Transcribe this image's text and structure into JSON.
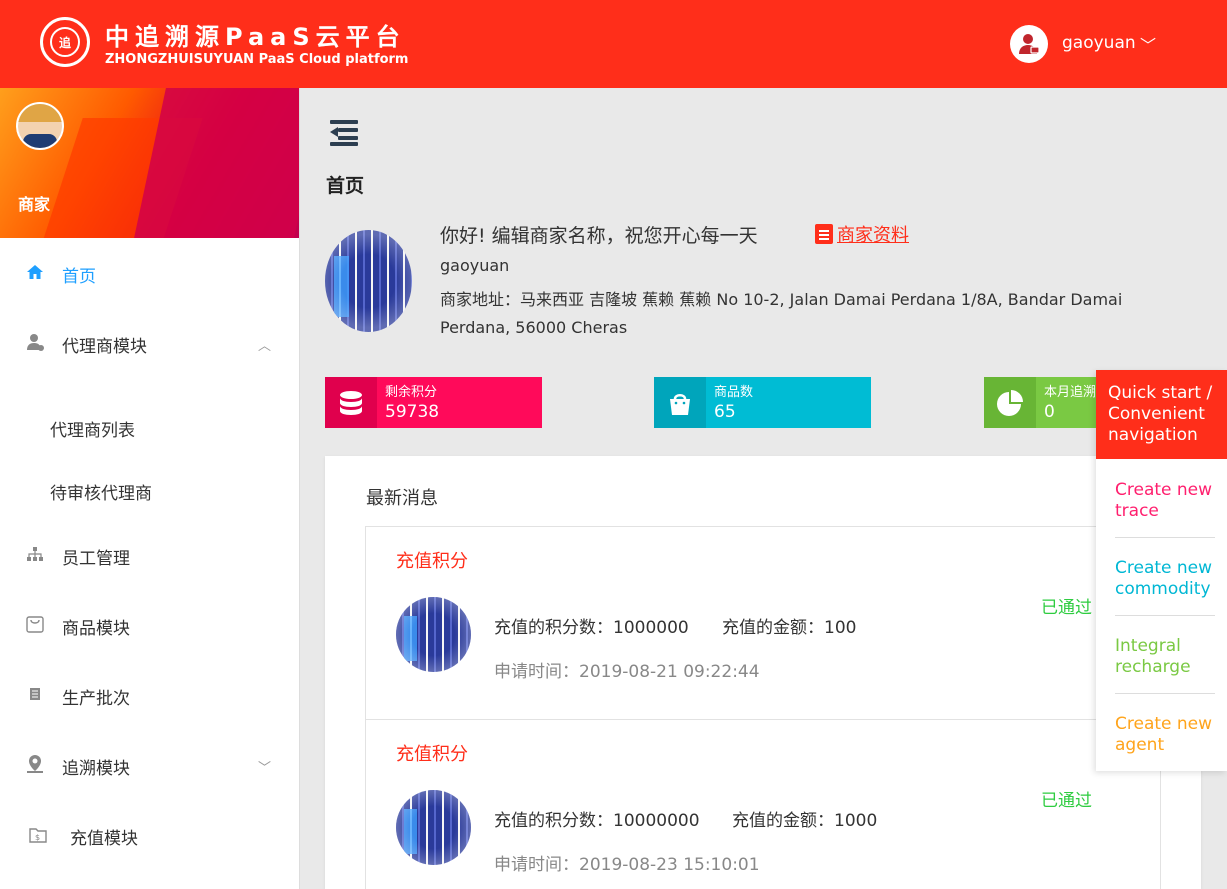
{
  "header": {
    "logo_text": "追",
    "brand_cn": "中追溯源PaaS云平台",
    "brand_en": "ZHONGZHUISUYUAN PaaS Cloud platform",
    "username": "gaoyuan",
    "chevron": "﹀"
  },
  "sidebar": {
    "role": "商家",
    "items": [
      {
        "label": "首页",
        "icon": "home-icon",
        "active": true
      },
      {
        "label": "代理商模块",
        "icon": "agent-icon",
        "expanded": true
      },
      {
        "label": "员工管理",
        "icon": "org-chart-icon"
      },
      {
        "label": "商品模块",
        "icon": "shopping-bag-icon"
      },
      {
        "label": "生产批次",
        "icon": "batch-icon"
      },
      {
        "label": "追溯模块",
        "icon": "location-icon",
        "expanded": false
      },
      {
        "label": "充值模块",
        "icon": "wallet-icon"
      }
    ],
    "subitems": [
      "代理商列表",
      "待审核代理商"
    ],
    "arrow_up": "︿",
    "arrow_down": "﹀"
  },
  "main": {
    "page_title": "首页",
    "greeting": "你好! 编辑商家名称，祝您开心每一天",
    "profile_link": "商家资料",
    "merchant_name": "gaoyuan",
    "address": "商家地址：马来西亚 吉隆坡 蕉赖 蕉赖 No 10-2, Jalan Damai Perdana 1/8A, Bandar Damai Perdana, 56000 Cheras"
  },
  "stats": [
    {
      "label": "剩余积分",
      "value": "59738",
      "color": "#ff0a5a",
      "icon": "database-icon"
    },
    {
      "label": "商品数",
      "value": "65",
      "color": "#00bcd4",
      "icon": "shopping-bag-icon"
    },
    {
      "label": "本月追溯",
      "value": "0",
      "color": "#7ac943",
      "icon": "pie-chart-icon"
    }
  ],
  "news": {
    "title": "最新消息",
    "items": [
      {
        "type": "充值积分",
        "points": "充值的积分数：1000000",
        "amount": "充值的金额：100",
        "time": "申请时间：2019-08-21 09:22:44",
        "status": "已通过"
      },
      {
        "type": "充值积分",
        "points": "充值的积分数：10000000",
        "amount": "充值的金额：1000",
        "time": "申请时间：2019-08-23 15:10:01",
        "status": "已通过"
      }
    ]
  },
  "quick_nav": {
    "title": "Quick start / Convenient navigation",
    "items": [
      {
        "label": "Create new trace",
        "color": "#ff1f6e"
      },
      {
        "label": "Create new commodity",
        "color": "#00b7d4"
      },
      {
        "label": "Integral recharge",
        "color": "#7ac943"
      },
      {
        "label": "Create new agent",
        "color": "#ffa41c"
      }
    ]
  }
}
